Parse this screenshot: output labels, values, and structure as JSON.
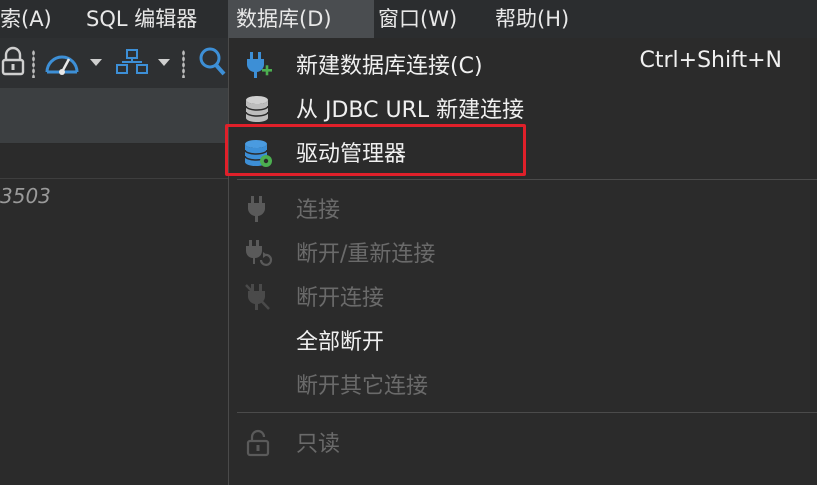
{
  "menubar": {
    "items": [
      {
        "label": "索(A)"
      },
      {
        "label": "SQL 编辑器"
      },
      {
        "label": "数据库(D)"
      },
      {
        "label": "窗口(W)"
      },
      {
        "label": "帮助(H)"
      }
    ]
  },
  "left": {
    "partial_text": "3503"
  },
  "menu": {
    "items": [
      {
        "label": "新建数据库连接(C)",
        "shortcut": "Ctrl+Shift+N",
        "icon": "plug-plus-icon",
        "enabled": true
      },
      {
        "label": "从 JDBC URL 新建连接",
        "icon": "database-icon",
        "enabled": true
      },
      {
        "label": "驱动管理器",
        "icon": "database-gear-icon",
        "enabled": true
      },
      {
        "label": "连接",
        "icon": "plug-icon",
        "enabled": false
      },
      {
        "label": "断开/重新连接",
        "icon": "plug-refresh-icon",
        "enabled": false
      },
      {
        "label": "断开连接",
        "icon": "plug-disconnect-icon",
        "enabled": false
      },
      {
        "label": "全部断开",
        "icon": "",
        "enabled": true
      },
      {
        "label": "断开其它连接",
        "icon": "",
        "enabled": false
      },
      {
        "label": "只读",
        "icon": "lock-icon",
        "enabled": false
      }
    ]
  },
  "colors": {
    "highlight": "#e0202a",
    "plug_blue": "#3d8fd6",
    "plus_green": "#4caf50"
  }
}
